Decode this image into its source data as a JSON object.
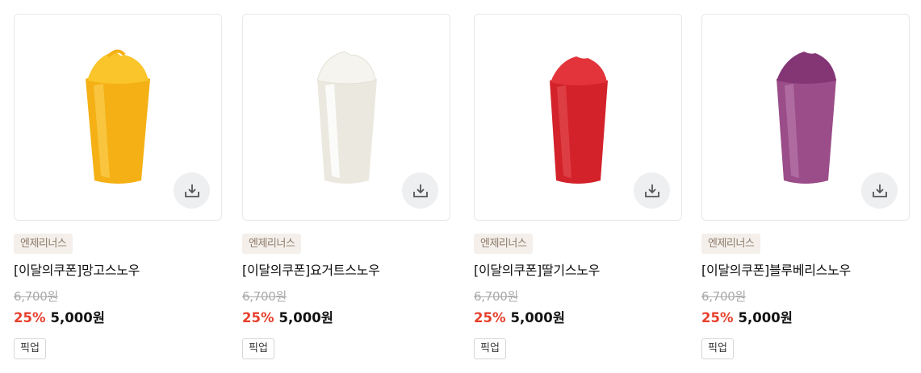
{
  "products": [
    {
      "brand": "엔제리너스",
      "title": "[이달의쿠폰]망고스노우",
      "original_price": "6,700원",
      "discount": "25%",
      "sale_price": "5,000원",
      "tag": "픽업",
      "color": "#f6b81a",
      "top_color": "#f9c52a"
    },
    {
      "brand": "엔제리너스",
      "title": "[이달의쿠폰]요거트스노우",
      "original_price": "6,700원",
      "discount": "25%",
      "sale_price": "5,000원",
      "tag": "픽업",
      "color": "#f1efe6",
      "top_color": "#f7f6f0"
    },
    {
      "brand": "엔제리너스",
      "title": "[이달의쿠폰]딸기스노우",
      "original_price": "6,700원",
      "discount": "25%",
      "sale_price": "5,000원",
      "tag": "픽업",
      "color": "#d8262b",
      "top_color": "#e2343a"
    },
    {
      "brand": "엔제리너스",
      "title": "[이달의쿠폰]블루베리스노우",
      "original_price": "6,700원",
      "discount": "25%",
      "sale_price": "5,000원",
      "tag": "픽업",
      "color": "#9b4f88",
      "top_color": "#8a3a78"
    }
  ],
  "icons": {
    "download": "download-icon"
  }
}
